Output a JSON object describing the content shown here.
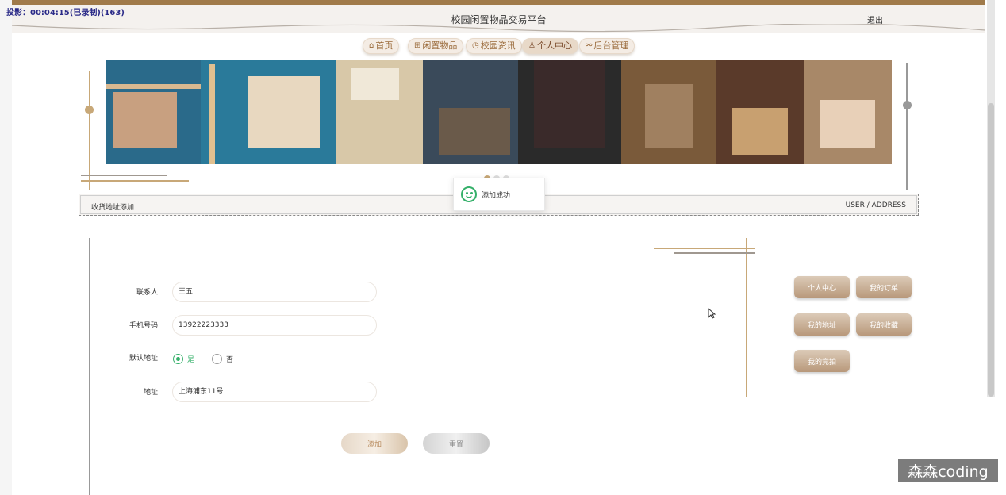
{
  "recording_time": "投影：00:04:15(已录制)(163)",
  "header": {
    "title": "校园闲置物品交易平台",
    "logout": "退出"
  },
  "nav": [
    {
      "label": "首页",
      "icon": "home-icon",
      "glyph": "⌂"
    },
    {
      "label": "闲置物品",
      "icon": "grid-icon",
      "glyph": "⊞"
    },
    {
      "label": "校园资讯",
      "icon": "clock-icon",
      "glyph": "◷"
    },
    {
      "label": "个人中心",
      "icon": "user-icon",
      "glyph": "♙"
    },
    {
      "label": "后台管理",
      "icon": "link-icon",
      "glyph": "⚯"
    }
  ],
  "toast": {
    "message": "添加成功"
  },
  "breadcrumb": {
    "left": "收货地址添加",
    "right": "USER / ADDRESS"
  },
  "form": {
    "contact_label": "联系人:",
    "contact_value": "王五",
    "phone_label": "手机号码:",
    "phone_value": "13922223333",
    "default_label": "默认地址:",
    "default_yes": "是",
    "default_no": "否",
    "address_label": "地址:",
    "address_value": "上海浦东11号",
    "add_button": "添加",
    "reset_button": "重置"
  },
  "side_menu": {
    "personal_center": "个人中心",
    "my_orders": "我的订单",
    "my_address": "我的地址",
    "my_favorites": "我的收藏",
    "my_bids": "我的竞拍"
  },
  "watermark": "森森coding",
  "colors": {
    "accent": "#c8a878",
    "brand_brown": "#a07a4a",
    "success": "#35b06a"
  }
}
